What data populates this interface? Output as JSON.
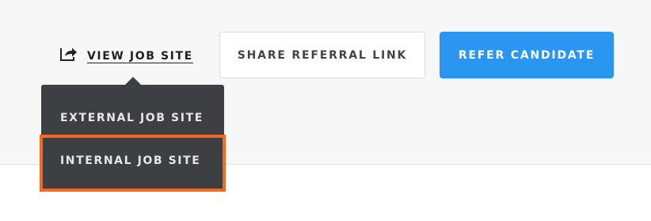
{
  "toolbar": {
    "view_job_site_label": "VIEW JOB SITE",
    "view_job_site_icon": "share-external-icon",
    "share_referral_label": "SHARE REFERRAL LINK",
    "refer_candidate_label": "REFER CANDIDATE"
  },
  "dropdown": {
    "items": [
      {
        "label": "EXTERNAL JOB SITE"
      },
      {
        "label": "INTERNAL JOB SITE"
      }
    ],
    "highlighted_item": "INTERNAL JOB SITE"
  },
  "colors": {
    "accent": "#2b95f2",
    "dropdown_bg": "#3e3f42",
    "highlight": "#f26a22",
    "band_bg": "#f7f7f7"
  }
}
